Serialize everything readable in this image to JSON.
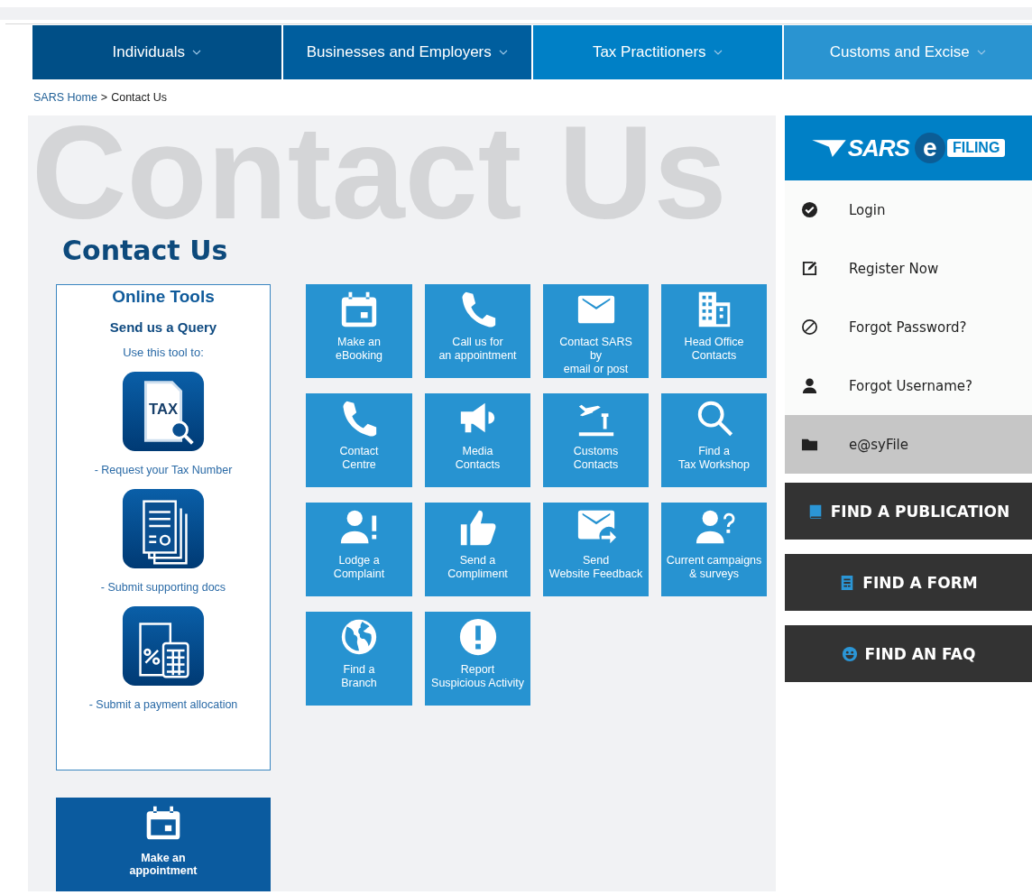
{
  "nav_tabs": [
    {
      "label": "Individuals",
      "color": "#004f87"
    },
    {
      "label": "Businesses and Employers",
      "color": "#005e9e"
    },
    {
      "label": "Tax Practitioners",
      "color": "#0080c6"
    },
    {
      "label": "Customs and Excise",
      "color": "#2a94d1"
    }
  ],
  "breadcrumb": {
    "link": "SARS Home",
    "separator": ">",
    "current": "Contact Us"
  },
  "page": {
    "background_title": "Contact Us",
    "title": "Contact Us"
  },
  "online_tools": {
    "title": "Online Tools",
    "subtitle": "Send us a Query",
    "intro": "Use this tool to:",
    "tools": [
      {
        "kind": "tax",
        "icon_text": "TAX",
        "label": "- Request your Tax Number"
      },
      {
        "kind": "documents",
        "label": "- Submit supporting docs"
      },
      {
        "kind": "calculator",
        "label": "- Submit a payment allocation"
      }
    ]
  },
  "tiles": [
    {
      "kind": "calendar",
      "lines": [
        "Make an",
        "eBooking"
      ]
    },
    {
      "kind": "phone",
      "lines": [
        "Call us for",
        "an appointment"
      ]
    },
    {
      "kind": "mail",
      "lines": [
        "Contact SARS",
        "by",
        "email or post"
      ]
    },
    {
      "kind": "building",
      "lines": [
        "Head Office",
        "Contacts"
      ]
    },
    {
      "kind": "phone",
      "lines": [
        "Contact",
        "Centre"
      ]
    },
    {
      "kind": "megaphone",
      "lines": [
        "Media",
        "Contacts"
      ]
    },
    {
      "kind": "airport",
      "lines": [
        "Customs",
        "Contacts"
      ]
    },
    {
      "kind": "search",
      "lines": [
        "Find a",
        "Tax Workshop"
      ]
    },
    {
      "kind": "person-alert",
      "lines": [
        "Lodge a",
        "Complaint"
      ]
    },
    {
      "kind": "thumbs-up",
      "lines": [
        "Send a",
        "Compliment"
      ]
    },
    {
      "kind": "mail-send",
      "lines": [
        "Send",
        "Website Feedback"
      ]
    },
    {
      "kind": "person-question",
      "lines": [
        "Current campaigns",
        "& surveys"
      ]
    },
    {
      "kind": "globe",
      "lines": [
        "Find a",
        "Branch"
      ]
    },
    {
      "kind": "alert",
      "lines": [
        "Report",
        "Suspicious Activity"
      ]
    }
  ],
  "appointment_button": {
    "kind": "calendar",
    "lines": [
      "Make an",
      "appointment"
    ]
  },
  "efiling": {
    "logo": [
      "SARS",
      "e",
      "FILING"
    ],
    "menu": [
      {
        "kind": "check",
        "label": "Login",
        "selected": false
      },
      {
        "kind": "edit",
        "label": "Register Now",
        "selected": false
      },
      {
        "kind": "ban",
        "label": "Forgot Password?",
        "selected": false
      },
      {
        "kind": "user",
        "label": "Forgot Username?",
        "selected": false
      },
      {
        "kind": "folder",
        "label": "e@syFile",
        "selected": true
      }
    ],
    "buttons": [
      {
        "kind": "book",
        "label": "FIND A PUBLICATION"
      },
      {
        "kind": "form",
        "label": "FIND A FORM"
      },
      {
        "kind": "smiley",
        "label": "FIND AN FAQ"
      }
    ]
  }
}
